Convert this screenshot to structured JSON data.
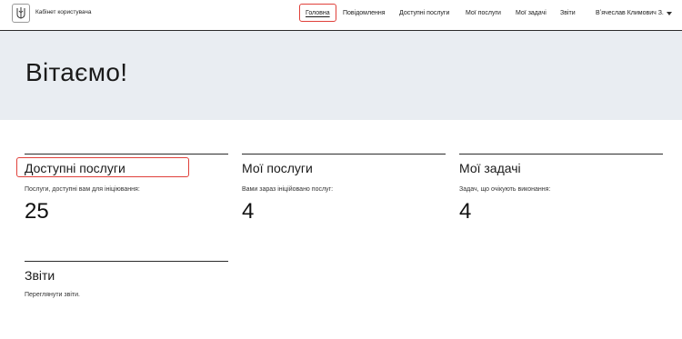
{
  "header": {
    "app_title": "Кабінет користувача",
    "nav": [
      {
        "label": "Головна",
        "active": true
      },
      {
        "label": "Повідомлення"
      },
      {
        "label": "Доступні послуги"
      },
      {
        "label": "Мої послуги"
      },
      {
        "label": "Мої задачі"
      },
      {
        "label": "Звіти"
      }
    ],
    "user_name": "Вʼячеслав Климович З."
  },
  "hero": {
    "title": "Вітаємо!"
  },
  "cards": [
    {
      "title": "Доступні послуги",
      "description": "Послуги, доступні вам для ініціювання:",
      "count": "25"
    },
    {
      "title": "Мої послуги",
      "description": "Вами зараз ініційовано послуг:",
      "count": "4"
    },
    {
      "title": "Мої задачі",
      "description": "Задач, що очікують виконання:",
      "count": "4"
    },
    {
      "title": "Звіти",
      "description": "Переглянути звіти."
    }
  ],
  "colors": {
    "highlight": "#e0403a",
    "hero_bg": "#e9edf2"
  }
}
